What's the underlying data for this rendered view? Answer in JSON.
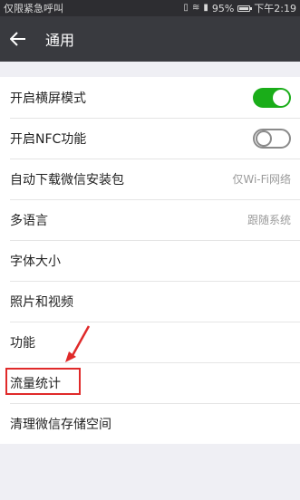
{
  "status_bar": {
    "carrier": "仅限紧急呼叫",
    "battery_percent": "95%",
    "time": "下午2:19"
  },
  "header": {
    "back_icon": "back-arrow-icon",
    "title": "通用"
  },
  "settings": {
    "landscape": {
      "label": "开启横屏模式",
      "enabled": true
    },
    "nfc": {
      "label": "开启NFC功能",
      "enabled": false
    },
    "auto_download": {
      "label": "自动下载微信安装包",
      "value": "仅Wi-Fi网络"
    },
    "language": {
      "label": "多语言",
      "value": "跟随系统"
    },
    "font_size": {
      "label": "字体大小"
    },
    "photos_videos": {
      "label": "照片和视频"
    },
    "features": {
      "label": "功能"
    },
    "data_usage": {
      "label": "流量统计"
    },
    "storage": {
      "label": "清理微信存储空间"
    }
  },
  "colors": {
    "title_bar": "#393a3f",
    "status_bar": "#2d2d31",
    "toggle_on": "#1aad19",
    "annotation": "#e02a2a"
  }
}
